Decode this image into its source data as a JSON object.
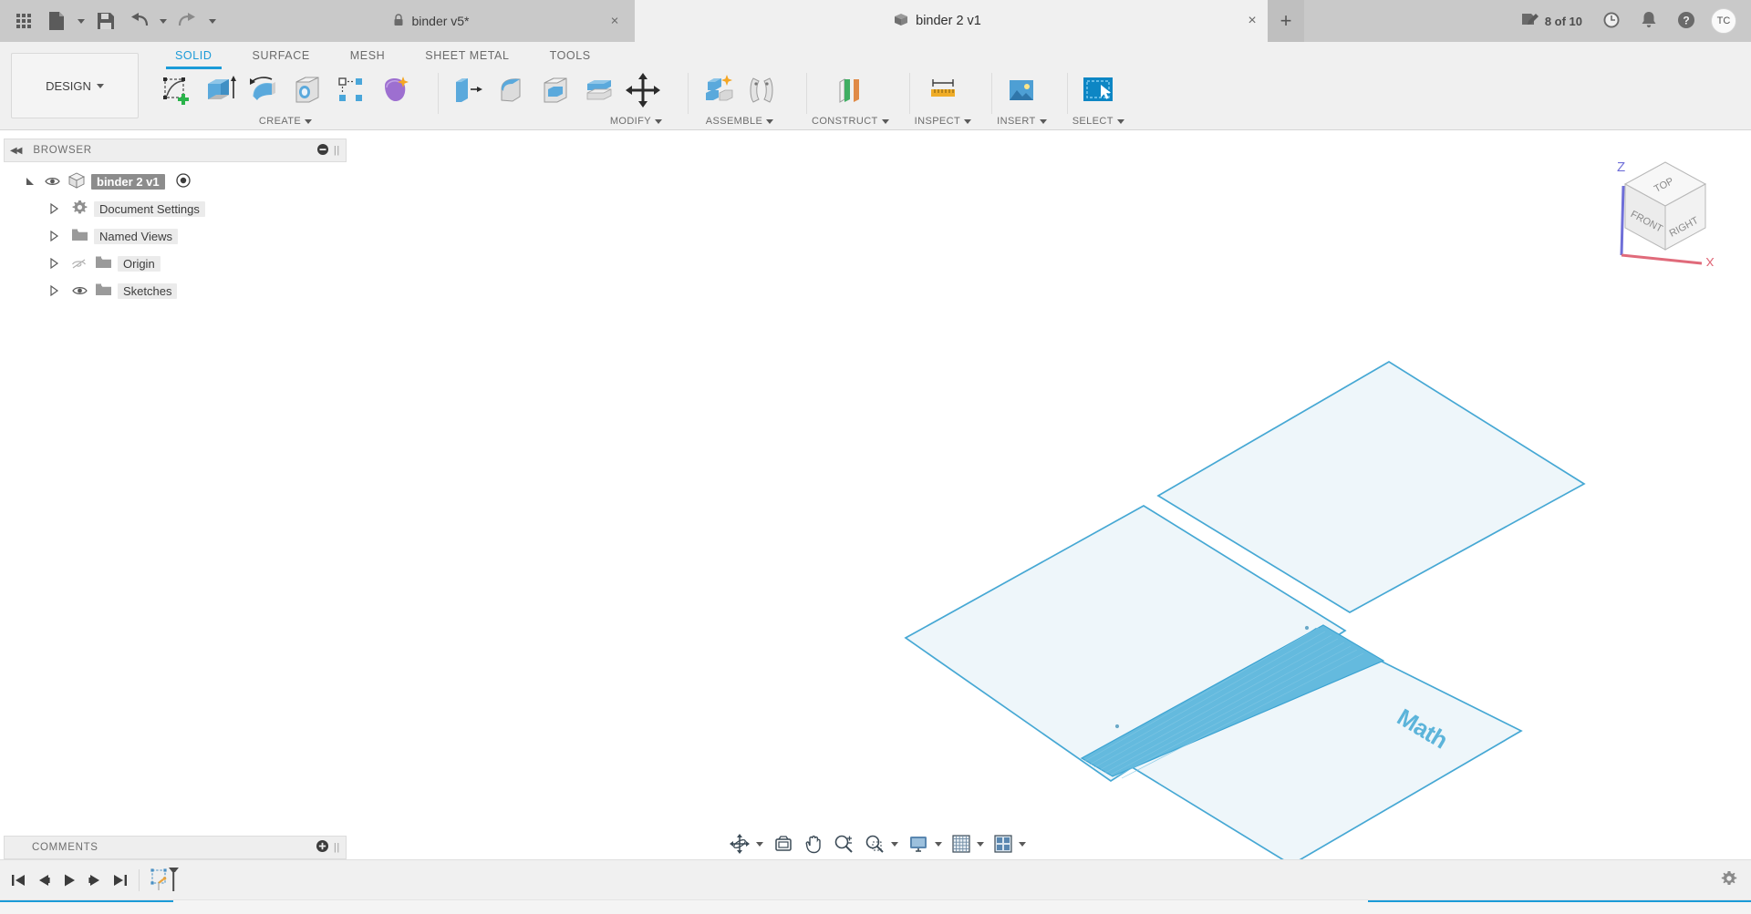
{
  "app": {
    "quick_access": [
      {
        "name": "app-grid-icon",
        "label": "Show Data Panel"
      },
      {
        "name": "file-icon",
        "label": "File"
      },
      {
        "name": "save-icon",
        "label": "Save"
      },
      {
        "name": "undo-icon",
        "label": "Undo"
      },
      {
        "name": "redo-icon",
        "label": "Redo"
      }
    ],
    "tabs": [
      {
        "title": "binder v5*",
        "locked": true,
        "active": false,
        "close": "×"
      },
      {
        "title": "binder 2 v1",
        "locked": false,
        "active": true,
        "close": "×"
      }
    ],
    "new_tab_label": "+",
    "job_status": "8 of 10",
    "top_right_icons": [
      {
        "name": "job-status-icon"
      },
      {
        "name": "recent-activity-clock-icon"
      },
      {
        "name": "notifications-bell-icon"
      },
      {
        "name": "help-icon"
      }
    ],
    "avatar_initials": "TC"
  },
  "ribbon": {
    "workspace": "DESIGN",
    "tabs": [
      {
        "label": "SOLID",
        "active": true
      },
      {
        "label": "SURFACE",
        "active": false
      },
      {
        "label": "MESH",
        "active": false
      },
      {
        "label": "SHEET METAL",
        "active": false
      },
      {
        "label": "TOOLS",
        "active": false
      }
    ],
    "panels": [
      {
        "label": "CREATE",
        "has_dropdown": true,
        "tools": [
          {
            "name": "create-sketch-icon",
            "title": "Create Sketch"
          },
          {
            "name": "extrude-icon",
            "title": "Extrude"
          },
          {
            "name": "revolve-icon",
            "title": "Revolve"
          },
          {
            "name": "hole-icon",
            "title": "Hole"
          },
          {
            "name": "pattern-icon",
            "title": "Rectangular Pattern"
          },
          {
            "name": "form-icon",
            "title": "Create Form"
          }
        ]
      },
      {
        "label": "MODIFY",
        "has_dropdown": true,
        "tools": [
          {
            "name": "press-pull-icon",
            "title": "Press Pull"
          },
          {
            "name": "fillet-icon",
            "title": "Fillet"
          },
          {
            "name": "shell-icon",
            "title": "Shell"
          },
          {
            "name": "combine-icon",
            "title": "Combine"
          },
          {
            "name": "offset-face-icon",
            "title": "Offset Face"
          },
          {
            "name": "move-copy-icon",
            "title": "Move/Copy"
          }
        ]
      },
      {
        "label": "ASSEMBLE",
        "has_dropdown": true,
        "tools": [
          {
            "name": "new-component-icon",
            "title": "New Component"
          },
          {
            "name": "joint-icon",
            "title": "Joint"
          }
        ]
      },
      {
        "label": "CONSTRUCT",
        "has_dropdown": true,
        "tools": [
          {
            "name": "offset-plane-icon",
            "title": "Offset Plane"
          }
        ]
      },
      {
        "label": "INSPECT",
        "has_dropdown": true,
        "tools": [
          {
            "name": "measure-icon",
            "title": "Measure"
          }
        ]
      },
      {
        "label": "INSERT",
        "has_dropdown": true,
        "tools": [
          {
            "name": "insert-image-icon",
            "title": "Canvas"
          }
        ]
      },
      {
        "label": "SELECT",
        "has_dropdown": true,
        "tools": [
          {
            "name": "select-icon",
            "title": "Select"
          }
        ]
      }
    ]
  },
  "browser": {
    "title": "BROWSER",
    "collapse_icon": "◀◀",
    "tree": [
      {
        "label": "binder 2 v1",
        "icon": "component-icon",
        "indent": 0,
        "eye": "visible",
        "root": true,
        "expanded": true,
        "activate_dot": true
      },
      {
        "label": "Document Settings",
        "icon": "gear-icon",
        "indent": 1,
        "eye": "none",
        "root": false,
        "expanded": false
      },
      {
        "label": "Named Views",
        "icon": "folder-icon",
        "indent": 1,
        "eye": "none",
        "root": false,
        "expanded": false
      },
      {
        "label": "Origin",
        "icon": "folder-icon",
        "indent": 1,
        "eye": "hidden",
        "root": false,
        "expanded": false
      },
      {
        "label": "Sketches",
        "icon": "folder-icon",
        "indent": 1,
        "eye": "visible",
        "root": false,
        "expanded": false
      }
    ]
  },
  "comments": {
    "title": "COMMENTS",
    "add_label": "+"
  },
  "canvas": {
    "viewcube": {
      "top": "TOP",
      "front": "FRONT",
      "right": "RIGHT",
      "axis_z": "Z",
      "axis_x": "X"
    },
    "model_text": "Math",
    "colors": {
      "face_fill": "#edf6fa",
      "edge": "#46a8d4",
      "selected_face": "#64bade",
      "accent": "#1b9bd8"
    },
    "bodies": [
      {
        "name": "sketch-plane-upper-right",
        "fill": "#eef6fa",
        "edge": "#46a8d4"
      },
      {
        "name": "sketch-plane-left",
        "fill": "#eef6fa",
        "edge": "#46a8d4"
      },
      {
        "name": "sketch-plane-lower-right",
        "fill": "#eef6fa",
        "edge": "#46a8d4"
      },
      {
        "name": "selected-spine-band",
        "fill": "#64bade",
        "edge": "#3ba3d2"
      }
    ]
  },
  "navbar": {
    "buttons": [
      {
        "name": "orbit-icon",
        "dropdown": true
      },
      {
        "name": "look-at-icon",
        "dropdown": false
      },
      {
        "name": "pan-icon",
        "dropdown": false
      },
      {
        "name": "zoom-icon",
        "dropdown": false
      },
      {
        "name": "zoom-window-icon",
        "dropdown": true
      },
      {
        "name": "display-settings-icon",
        "dropdown": true
      },
      {
        "name": "grid-snaps-icon",
        "dropdown": true
      },
      {
        "name": "viewports-icon",
        "dropdown": true
      }
    ]
  },
  "timeline": {
    "buttons": [
      {
        "name": "go-to-beginning-icon"
      },
      {
        "name": "step-back-icon"
      },
      {
        "name": "play-icon"
      },
      {
        "name": "step-forward-icon"
      },
      {
        "name": "go-to-end-icon"
      }
    ],
    "features": [
      {
        "name": "sketch-feature-icon",
        "title": "Sketch1"
      }
    ],
    "settings_icon": "timeline-settings-gear-icon"
  }
}
